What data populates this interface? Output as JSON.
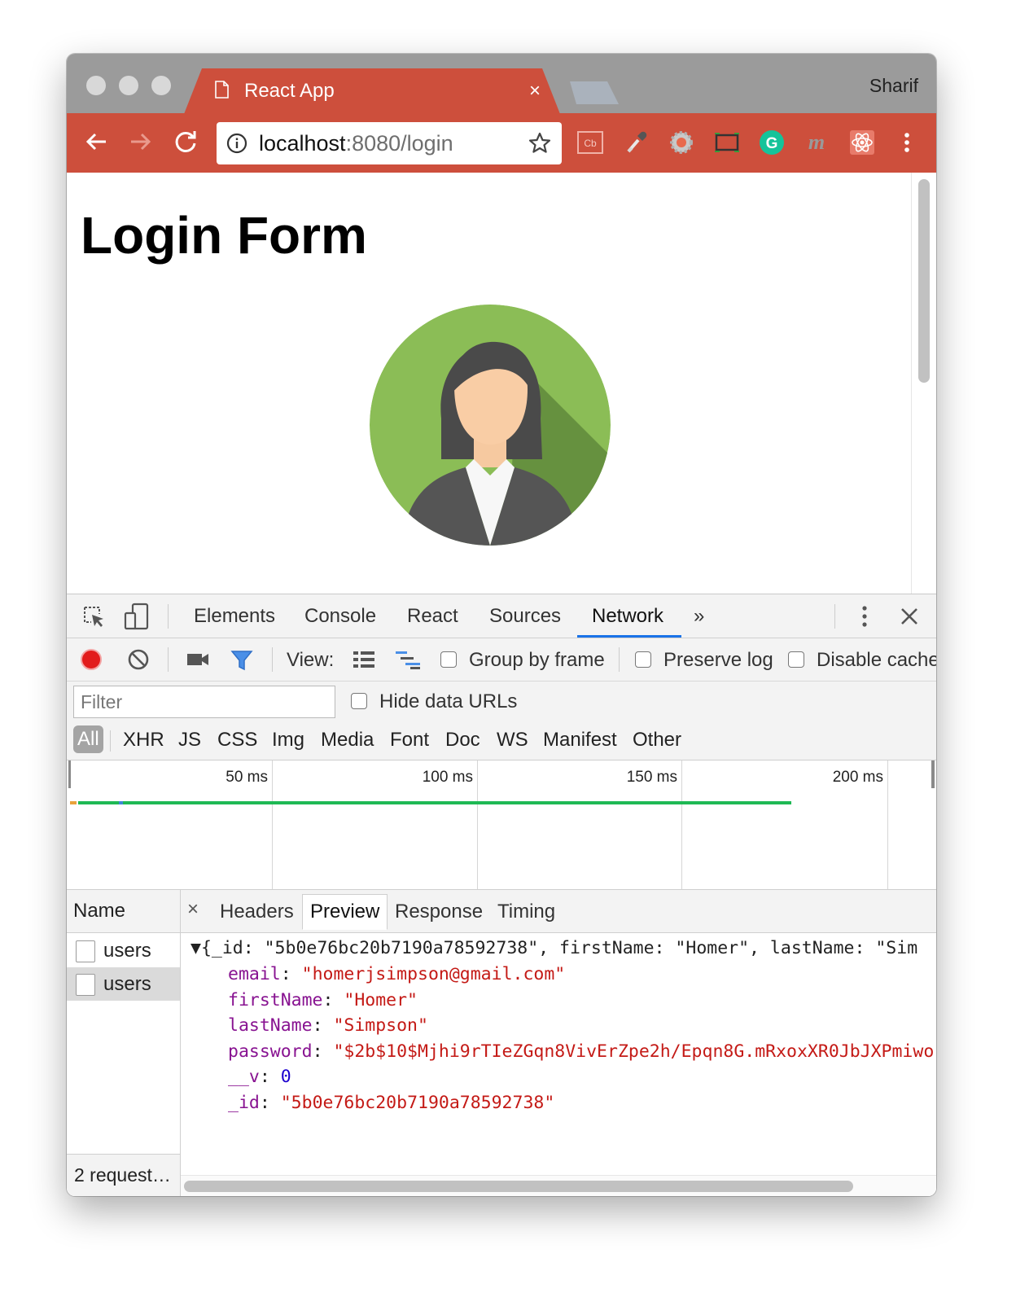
{
  "browser": {
    "tab_title": "React App",
    "tab_close": "×",
    "profile_name": "Sharif",
    "url_host": "localhost",
    "url_rest": ":8080/login",
    "extensions": [
      "cb-extension-icon",
      "eyedropper-icon",
      "gear-extension-icon",
      "window-resizer-icon",
      "grammarly-icon",
      "m-extension-icon",
      "react-devtools-icon"
    ],
    "ext_cb_label": "Cb",
    "ext_g_label": "G",
    "ext_m_label": "m",
    "colors": {
      "chrome_accent": "#cd4f3c",
      "tabstrip": "#9b9b9b"
    }
  },
  "page": {
    "title": "Login Form",
    "avatar": "businesswoman-avatar"
  },
  "devtools": {
    "tabs": [
      "Elements",
      "Console",
      "React",
      "Sources",
      "Network"
    ],
    "active_tab": "Network",
    "more_tabs": "»",
    "network_toolbar": {
      "view_label": "View:",
      "group_by_frame": "Group by frame",
      "preserve_log": "Preserve log",
      "disable_cache": "Disable cache"
    },
    "filter": {
      "placeholder": "Filter",
      "hide_data_urls": "Hide data URLs"
    },
    "types": [
      "All",
      "XHR",
      "JS",
      "CSS",
      "Img",
      "Media",
      "Font",
      "Doc",
      "WS",
      "Manifest",
      "Other"
    ],
    "timeline_ticks": [
      "50 ms",
      "100 ms",
      "150 ms",
      "200 ms"
    ],
    "requests": {
      "header": "Name",
      "items": [
        "users",
        "users"
      ],
      "status": "2 request…"
    },
    "detail": {
      "close": "×",
      "tabs": [
        "Headers",
        "Preview",
        "Response",
        "Timing"
      ],
      "active_tab": "Preview",
      "preview": {
        "summary": "▼{_id: \"5b0e76bc20b7190a78592738\", firstName: \"Homer\", lastName: \"Sim",
        "fields": [
          {
            "key": "email",
            "value": "\"homerjsimpson@gmail.com\"",
            "type": "string"
          },
          {
            "key": "firstName",
            "value": "\"Homer\"",
            "type": "string"
          },
          {
            "key": "lastName",
            "value": "\"Simpson\"",
            "type": "string"
          },
          {
            "key": "password",
            "value": "\"$2b$10$Mjhi9rTIeZGqn8VivErZpe2h/Epqn8G.mRxoxXR0JbJXPmiwo",
            "type": "string"
          },
          {
            "key": "__v",
            "value": "0",
            "type": "number"
          },
          {
            "key": "_id",
            "value": "\"5b0e76bc20b7190a78592738\"",
            "type": "string"
          }
        ]
      }
    }
  }
}
